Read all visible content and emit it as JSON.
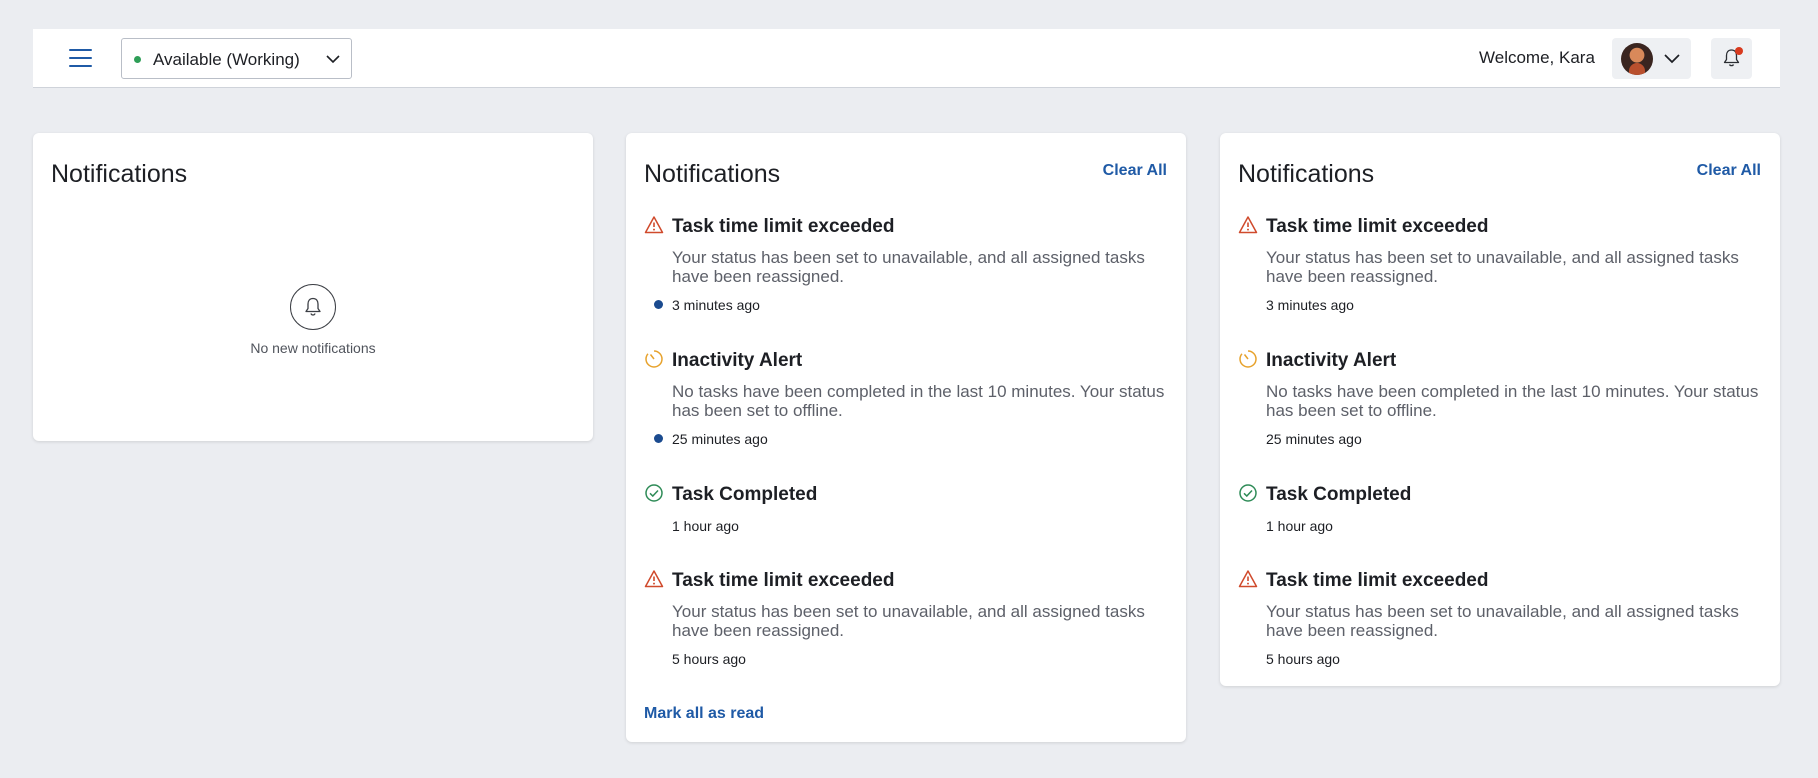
{
  "header": {
    "status": {
      "label": "Available (Working)",
      "color": "#2e9e57"
    },
    "welcome": "Welcome, Kara",
    "accent": "#1f5aa6"
  },
  "cards": [
    {
      "title": "Notifications",
      "empty_text": "No new notifications"
    },
    {
      "title": "Notifications",
      "clear_all": "Clear All",
      "mark_all_read": "Mark all as read",
      "items": [
        {
          "icon": "warning-icon",
          "title": "Task time limit exceeded",
          "body": "Your status has been set to unavailable, and all assigned tasks have been reassigned.",
          "time": "3 minutes ago",
          "unread": true
        },
        {
          "icon": "timer-icon",
          "title": "Inactivity Alert",
          "body": "No tasks have been completed in the last 10 minutes. Your status has been set to offline.",
          "time": "25 minutes ago",
          "unread": true
        },
        {
          "icon": "check-circle-icon",
          "title": "Task Completed",
          "body": "",
          "time": "1 hour ago",
          "unread": false
        },
        {
          "icon": "warning-icon",
          "title": "Task time limit exceeded",
          "body": "Your status has been set to unavailable, and all assigned tasks have been reassigned.",
          "time": "5 hours ago",
          "unread": false
        }
      ]
    },
    {
      "title": "Notifications",
      "clear_all": "Clear All",
      "items": [
        {
          "icon": "warning-icon",
          "title": "Task time limit exceeded",
          "body": "Your status has been set to unavailable, and all assigned tasks have been reassigned.",
          "time": "3 minutes ago",
          "unread": false
        },
        {
          "icon": "timer-icon",
          "title": "Inactivity Alert",
          "body": "No tasks have been completed in the last 10 minutes. Your status has been set to offline.",
          "time": "25 minutes ago",
          "unread": false
        },
        {
          "icon": "check-circle-icon",
          "title": "Task Completed",
          "body": "",
          "time": "1 hour ago",
          "unread": false
        },
        {
          "icon": "warning-icon",
          "title": "Task time limit exceeded",
          "body": "Your status has been set to unavailable, and all assigned tasks have been reassigned.",
          "time": "5 hours ago",
          "unread": false
        }
      ]
    }
  ]
}
